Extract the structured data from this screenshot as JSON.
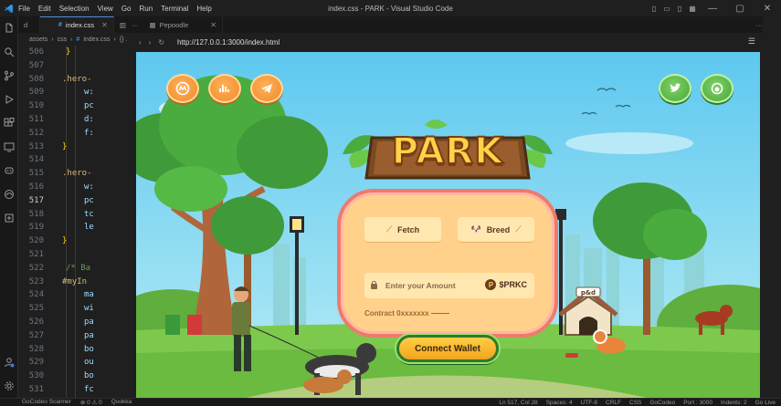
{
  "window": {
    "title": "index.css - PARK - Visual Studio Code",
    "menu": [
      "File",
      "Edit",
      "Selection",
      "View",
      "Go",
      "Run",
      "Terminal",
      "Help"
    ]
  },
  "tabs": [
    {
      "label": "d",
      "active": false
    },
    {
      "label": "index.css",
      "active": true
    },
    {
      "label": "Pepoodle",
      "active": false
    }
  ],
  "breadcrumb": [
    "assets",
    "css",
    "index.css",
    "{} ."
  ],
  "editor": {
    "current_line": "517",
    "lines": [
      {
        "n": "506",
        "text": "}",
        "cls": "brace",
        "indent": 52
      },
      {
        "n": "507",
        "text": "",
        "cls": "",
        "indent": 0
      },
      {
        "n": "508",
        "text": ".hero-",
        "cls": "sel",
        "indent": 48
      },
      {
        "n": "509",
        "text": "w:",
        "cls": "prop",
        "indent": 72
      },
      {
        "n": "510",
        "text": "pc",
        "cls": "prop",
        "indent": 72
      },
      {
        "n": "511",
        "text": "d:",
        "cls": "prop",
        "indent": 72
      },
      {
        "n": "512",
        "text": "f:",
        "cls": "prop",
        "indent": 72
      },
      {
        "n": "513",
        "text": "}",
        "cls": "brace",
        "indent": 48
      },
      {
        "n": "514",
        "text": "",
        "cls": "",
        "indent": 0
      },
      {
        "n": "515",
        "text": ".hero-",
        "cls": "sel",
        "indent": 48
      },
      {
        "n": "516",
        "text": "w:",
        "cls": "prop",
        "indent": 72
      },
      {
        "n": "517",
        "text": "pc",
        "cls": "prop",
        "indent": 72
      },
      {
        "n": "518",
        "text": "tc",
        "cls": "prop",
        "indent": 72
      },
      {
        "n": "519",
        "text": "le",
        "cls": "prop",
        "indent": 72
      },
      {
        "n": "520",
        "text": "}",
        "cls": "brace",
        "indent": 48
      },
      {
        "n": "521",
        "text": "",
        "cls": "",
        "indent": 0
      },
      {
        "n": "522",
        "text": "/* Ba",
        "cls": "cmt",
        "indent": 52
      },
      {
        "n": "523",
        "text": "#myIn",
        "cls": "id",
        "indent": 48
      },
      {
        "n": "524",
        "text": "ma",
        "cls": "prop",
        "indent": 72
      },
      {
        "n": "525",
        "text": "wi",
        "cls": "prop",
        "indent": 72
      },
      {
        "n": "526",
        "text": "pa",
        "cls": "prop",
        "indent": 72
      },
      {
        "n": "527",
        "text": "pa",
        "cls": "prop",
        "indent": 72
      },
      {
        "n": "528",
        "text": "bo",
        "cls": "prop",
        "indent": 72
      },
      {
        "n": "529",
        "text": "ou",
        "cls": "prop",
        "indent": 72
      },
      {
        "n": "530",
        "text": "bo",
        "cls": "prop",
        "indent": 72
      },
      {
        "n": "531",
        "text": "fc",
        "cls": "prop",
        "indent": 72
      }
    ]
  },
  "browser": {
    "url": "http://127.0.0.1:3000/index.html"
  },
  "page": {
    "logo_text": "PARK",
    "fetch_label": "Fetch",
    "breed_label": "Breed",
    "amount_placeholder": "Enter your Amount",
    "token": "$PRKC",
    "contract_label": "Contract 0xxxxxxx",
    "connect_label": "Connect Wallet",
    "doghouse_sign": "p&d"
  },
  "statusbar": {
    "left": [
      "GoCodeo Scanner",
      "⊗ 0 ⚠ 0",
      "Quokka"
    ],
    "right": [
      "Ln 517, Col 28",
      "Spaces: 4",
      "UTF-8",
      "CRLF",
      "CSS",
      "GoCodeo",
      "Port : 3000",
      "Indents: 2",
      "Go Live"
    ]
  },
  "colors": {
    "accent": "#4d8fdd",
    "panel": "#ffd18a",
    "panel_border": "#f07a6a",
    "connect": "#f3a41d"
  }
}
